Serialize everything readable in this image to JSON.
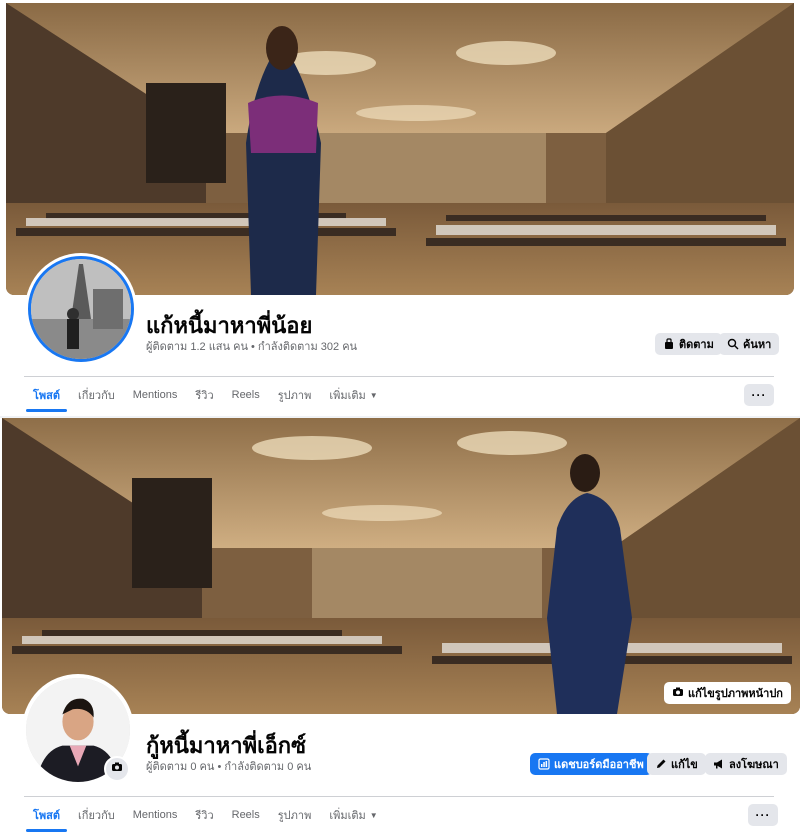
{
  "profiles": [
    {
      "name": "แก้หนี้มาหาพี่น้อย",
      "stats": "ผู้ติดตาม 1.2 แสน คน • กำลังติดตาม 302 คน",
      "buttons": {
        "follow": "ติดตาม",
        "search": "ค้นหา"
      },
      "tabs": [
        "โพสต์",
        "เกี่ยวกับ",
        "Mentions",
        "รีวิว",
        "Reels",
        "รูปภาพ",
        "เพิ่มเติม"
      ],
      "more_label": "···",
      "icons": {
        "follow": "follow-icon",
        "search": "search-icon",
        "dropdown": "caret-down-icon"
      }
    },
    {
      "name": "กู้หนี้มาหาพี่เอ็กซ์",
      "stats": "ผู้ติดตาม 0 คน • กำลังติดตาม 0 คน",
      "edit_cover": "แก้ไขรูปภาพหน้าปก",
      "buttons": {
        "dashboard": "แดชบอร์ดมืออาชีพ",
        "edit": "แก้ไข",
        "advertise": "ลงโฆษณา"
      },
      "tabs": [
        "โพสต์",
        "เกี่ยวกับ",
        "Mentions",
        "รีวิว",
        "Reels",
        "รูปภาพ",
        "เพิ่มเติม"
      ],
      "more_label": "···",
      "icons": {
        "camera": "camera-icon",
        "dashboard": "chart-icon",
        "edit": "pencil-icon",
        "advertise": "megaphone-icon"
      }
    }
  ],
  "colors": {
    "accent": "#1877f2",
    "button_bg": "#e4e6eb",
    "text_secondary": "#65676b"
  }
}
